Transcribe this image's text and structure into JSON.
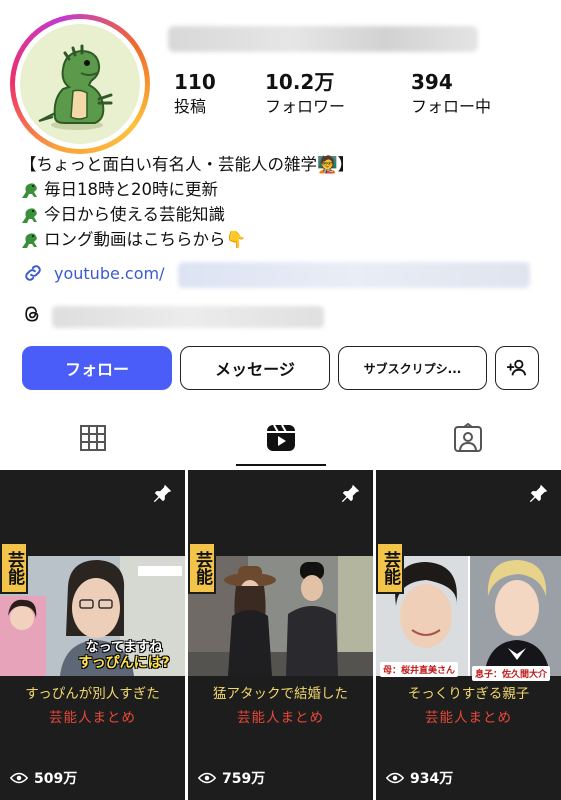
{
  "profile": {
    "username": "",
    "stats": [
      {
        "value": "110",
        "label": "投稿"
      },
      {
        "value": "10.2万",
        "label": "フォロワー"
      },
      {
        "value": "394",
        "label": "フォロー中"
      }
    ],
    "bio_lines": [
      "【ちょっと面白い有名人・芸能人の雑学🧑‍🏫】",
      "毎日18時と20時に更新",
      "今日から使える芸能知識",
      "ロング動画はこちらから👇"
    ],
    "link_text": "youtube.com/"
  },
  "buttons": {
    "follow": "フォロー",
    "message": "メッセージ",
    "subscribe": "サブスクリプシ..."
  },
  "tabs": [
    "grid-icon",
    "reels-icon",
    "tagged-icon"
  ],
  "reels": [
    {
      "badge": "芸能",
      "overlay_line1": "なってますね",
      "overlay_line2": "すっぴんには?",
      "caption_line1": "すっぴんが別人すぎた",
      "caption_line2": "芸能人まとめ",
      "views": "509万"
    },
    {
      "badge": "芸能",
      "caption_line1": "猛アタックで結婚した",
      "caption_line2": "芸能人まとめ",
      "views": "759万"
    },
    {
      "badge": "芸能",
      "label_left": "母：桜井直美さん",
      "label_right": "息子：佐久間大介",
      "caption_line1": "そっくりすぎる親子",
      "caption_line2": "芸能人まとめ",
      "views": "934万"
    }
  ],
  "colors": {
    "follow_button": "#4a5df8",
    "link": "#3a5bd0",
    "caption_yellow": "#f3d76a",
    "caption_red": "#e8483a",
    "badge": "#f2c44a"
  }
}
